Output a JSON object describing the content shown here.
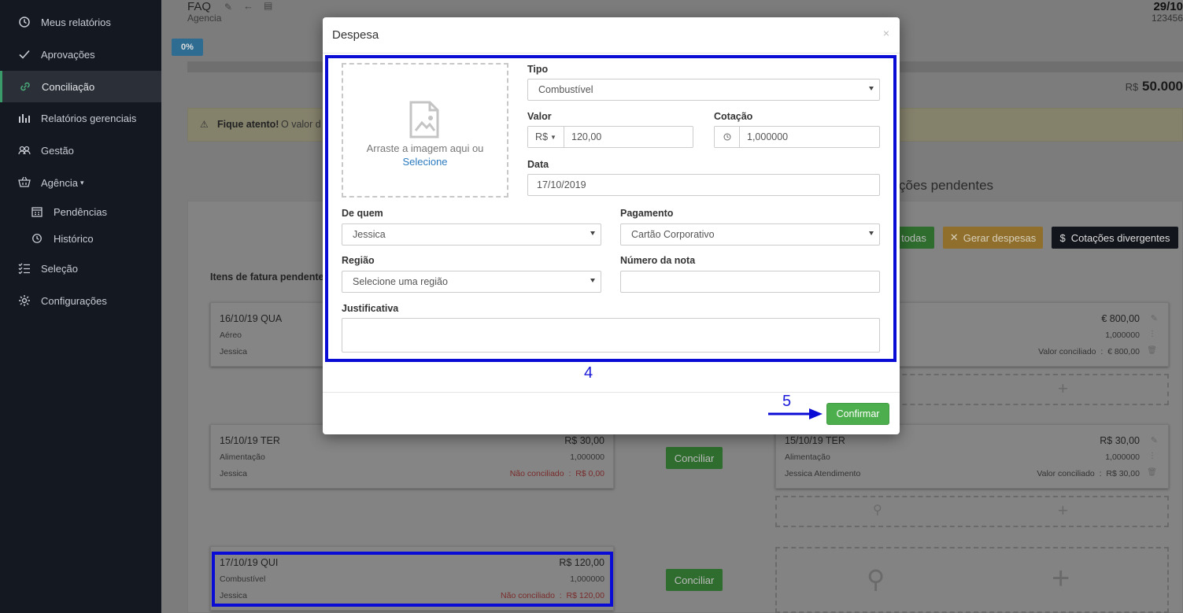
{
  "sidebar": {
    "items": [
      {
        "label": "Meus relatórios",
        "icon": "history-icon"
      },
      {
        "label": "Aprovações",
        "icon": "check-icon"
      },
      {
        "label": "Conciliação",
        "icon": "link-icon",
        "active": true
      },
      {
        "label": "Relatórios gerenciais",
        "icon": "bar-chart-icon"
      },
      {
        "label": "Gestão",
        "icon": "users-icon"
      },
      {
        "label": "Agência",
        "icon": "basket-icon",
        "has_dropdown": true
      },
      {
        "label": "Pendências",
        "icon": "calendar-icon",
        "sub": true
      },
      {
        "label": "Histórico",
        "icon": "history-icon",
        "sub": true
      },
      {
        "label": "Seleção",
        "icon": "list-check-icon"
      },
      {
        "label": "Configurações",
        "icon": "gear-icon"
      }
    ]
  },
  "background": {
    "header_title": "FAQ",
    "header_subtitle": "Agencia",
    "header_date": "29/10",
    "header_code": "123456",
    "progress_badge": "0%",
    "total_currency": "R$",
    "total_value": "50.000",
    "alert_bold": "Fique atento!",
    "alert_text": "O valor d",
    "section_title": "liações pendentes",
    "pending_items_title": "Itens de fatura pendentes",
    "btn_todas": "todas",
    "btn_gerar": "Gerar despesas",
    "btn_cotacoes": "Cotações divergentes",
    "conciliar_label": "Conciliar",
    "left_cards": [
      {
        "date": "16/10/19 QUA",
        "category": "Aéreo",
        "person": "Jessica",
        "amount": "",
        "rate": "",
        "status": "",
        "status_value": ""
      },
      {
        "date": "15/10/19 TER",
        "category": "Alimentação",
        "person": "Jessica",
        "amount": "R$ 30,00",
        "rate": "1,000000",
        "status": "Não conciliado",
        "status_value": "R$ 0,00"
      },
      {
        "date": "17/10/19 QUI",
        "category": "Combustível",
        "person": "Jessica",
        "amount": "R$ 120,00",
        "rate": "1,000000",
        "status": "Não conciliado",
        "status_value": "R$ 120,00"
      }
    ],
    "right_cards": [
      {
        "date": "",
        "category": "",
        "person": "",
        "amount": "€ 800,00",
        "rate": "1,000000",
        "status": "Valor conciliado",
        "status_value": "€ 800,00"
      },
      {
        "date": "15/10/19 TER",
        "category": "Alimentação",
        "person": "Jessica Atendimento",
        "amount": "R$ 30,00",
        "rate": "1,000000",
        "status": "Valor conciliado",
        "status_value": "R$ 30,00"
      }
    ],
    "colon": ":"
  },
  "modal": {
    "title": "Despesa",
    "close": "×",
    "dropzone_text": "Arraste a imagem aqui ou",
    "dropzone_link": "Selecione",
    "tipo_label": "Tipo",
    "tipo_value": "Combustível",
    "valor_label": "Valor",
    "valor_currency": "R$",
    "valor_value": "120,00",
    "cotacao_label": "Cotação",
    "cotacao_value": "1,000000",
    "data_label": "Data",
    "data_value": "17/10/2019",
    "de_quem_label": "De quem",
    "de_quem_value": "Jessica",
    "pagamento_label": "Pagamento",
    "pagamento_value": "Cartão Corporativo",
    "regiao_label": "Região",
    "regiao_value": "Selecione uma região",
    "numero_nota_label": "Número da nota",
    "numero_nota_value": "",
    "justificativa_label": "Justificativa",
    "justificativa_value": "",
    "confirm_label": "Confirmar"
  },
  "annotations": {
    "step4": "4",
    "step5": "5"
  },
  "colors": {
    "sidebar_bg": "#141821",
    "annotation_blue": "#0b0bd6",
    "confirm_green": "#4cae4c",
    "link_blue": "#2a7abf",
    "alert_red": "#a94442"
  }
}
